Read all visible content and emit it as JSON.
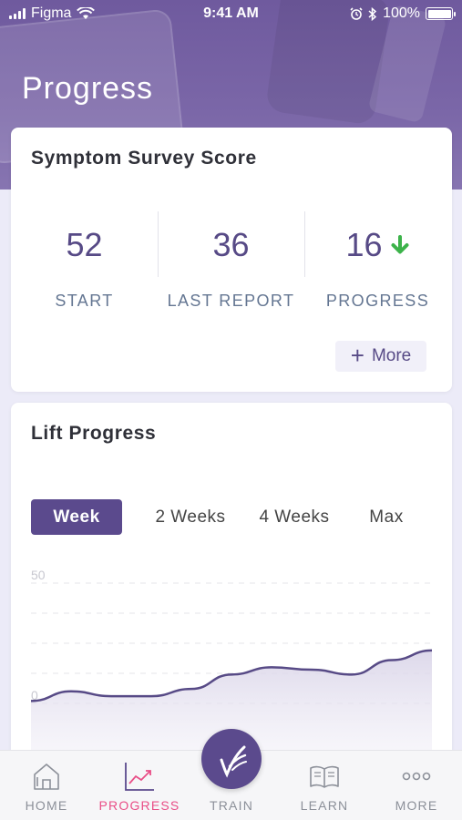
{
  "status_bar": {
    "carrier": "Figma",
    "time": "9:41 AM",
    "battery": "100%"
  },
  "header": {
    "title": "Progress"
  },
  "survey_card": {
    "title": "Symptom Survey Score",
    "stats": [
      {
        "value": "52",
        "label": "START"
      },
      {
        "value": "36",
        "label": "LAST REPORT"
      },
      {
        "value": "16",
        "label": "PROGRESS",
        "trend": "down-arrow-icon"
      }
    ],
    "more_label": "More"
  },
  "lift_card": {
    "title": "Lift Progress",
    "tabs": [
      "Week",
      "2 Weeks",
      "4 Weeks",
      "Max"
    ],
    "active_tab": "Week"
  },
  "chart_data": {
    "type": "area",
    "title": "",
    "xlabel": "",
    "ylabel": "",
    "ylim": [
      0,
      50
    ],
    "y_ticks": [
      "50",
      "0"
    ],
    "grid": true,
    "x": [
      0,
      1,
      2,
      3,
      4,
      5,
      6,
      7,
      8,
      9,
      10
    ],
    "values": [
      1,
      5,
      3,
      3,
      6,
      12,
      15,
      14,
      12,
      18,
      22
    ],
    "line_color": "#574a86"
  },
  "tab_bar": {
    "items": [
      {
        "label": "HOME",
        "icon": "home-icon"
      },
      {
        "label": "PROGRESS",
        "icon": "chart-icon"
      },
      {
        "label": "TRAIN",
        "icon": "train-logo-icon"
      },
      {
        "label": "LEARN",
        "icon": "book-icon"
      },
      {
        "label": "MORE",
        "icon": "more-dots-icon"
      }
    ],
    "active": "PROGRESS"
  },
  "colors": {
    "brand_purple": "#5b4a8d",
    "active_pink": "#e94e87",
    "trend_green": "#3cb34a"
  }
}
